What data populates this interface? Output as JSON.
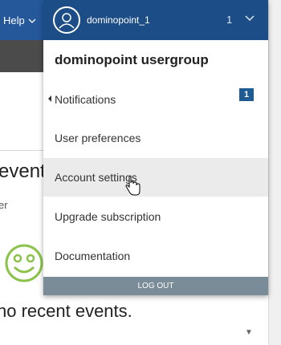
{
  "topbar": {
    "help_label": "Help"
  },
  "background": {
    "events_title": "event",
    "filter_text": "er",
    "no_events": "no recent events."
  },
  "dropdown": {
    "username": "dominopoint_1",
    "count": "1",
    "group_name": "dominopoint usergroup",
    "items": [
      {
        "label": "Notifications",
        "badge": "1"
      },
      {
        "label": "User preferences"
      },
      {
        "label": "Account settings"
      },
      {
        "label": "Upgrade subscription"
      },
      {
        "label": "Documentation"
      }
    ],
    "logout_label": "LOG OUT"
  },
  "colors": {
    "topbar": "#24589a",
    "header": "#1d4d87",
    "badge": "#1d5b92",
    "logout": "#7a8c97",
    "smiley": "#8bc34a"
  },
  "icons": [
    "user-avatar-icon",
    "chevron-down-icon",
    "caret-left-icon",
    "smiley-icon",
    "hand-cursor-icon",
    "scroll-down-icon"
  ]
}
